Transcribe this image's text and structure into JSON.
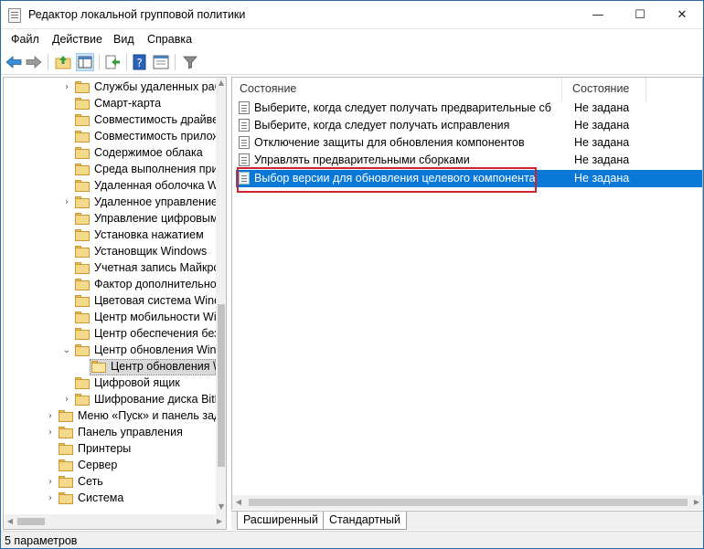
{
  "window": {
    "title": "Редактор локальной групповой политики",
    "minimize": "—",
    "maximize": "☐",
    "close": "✕"
  },
  "menu": [
    "Файл",
    "Действие",
    "Вид",
    "Справка"
  ],
  "toolbar": {
    "icons": [
      "back-arrow-icon",
      "forward-arrow-icon",
      "up-folder-icon",
      "show-hide-console-tree-icon",
      "export-list-icon",
      "help-icon",
      "properties-icon",
      "filter-icon"
    ]
  },
  "tree": {
    "items": [
      {
        "label": "Службы удаленных раб",
        "depth": 2,
        "chevron": "›"
      },
      {
        "label": "Смарт-карта",
        "depth": 2,
        "chevron": ""
      },
      {
        "label": "Совместимость драйве",
        "depth": 2,
        "chevron": ""
      },
      {
        "label": "Совместимость прилож",
        "depth": 2,
        "chevron": ""
      },
      {
        "label": "Содержимое облака",
        "depth": 2,
        "chevron": ""
      },
      {
        "label": "Среда выполнения при",
        "depth": 2,
        "chevron": ""
      },
      {
        "label": "Удаленная оболочка W",
        "depth": 2,
        "chevron": ""
      },
      {
        "label": "Удаленное управление",
        "depth": 2,
        "chevron": "›"
      },
      {
        "label": "Управление цифровым",
        "depth": 2,
        "chevron": ""
      },
      {
        "label": "Установка нажатием",
        "depth": 2,
        "chevron": ""
      },
      {
        "label": "Установщик Windows",
        "depth": 2,
        "chevron": ""
      },
      {
        "label": "Учетная запись Майкро",
        "depth": 2,
        "chevron": ""
      },
      {
        "label": "Фактор дополнительно",
        "depth": 2,
        "chevron": ""
      },
      {
        "label": "Цветовая система Wind",
        "depth": 2,
        "chevron": ""
      },
      {
        "label": "Центр мобильности Wi",
        "depth": 2,
        "chevron": ""
      },
      {
        "label": "Центр обеспечения без",
        "depth": 2,
        "chevron": ""
      },
      {
        "label": "Центр обновления Win",
        "depth": 2,
        "chevron": "⌄"
      },
      {
        "label": "Центр обновления \\",
        "depth": 3,
        "chevron": "",
        "selected": true
      },
      {
        "label": "Цифровой ящик",
        "depth": 2,
        "chevron": ""
      },
      {
        "label": "Шифрование диска BitL",
        "depth": 2,
        "chevron": "›"
      },
      {
        "label": "Меню «Пуск» и панель зада",
        "depth": 1,
        "chevron": "›"
      },
      {
        "label": "Панель управления",
        "depth": 1,
        "chevron": "›"
      },
      {
        "label": "Принтеры",
        "depth": 1,
        "chevron": ""
      },
      {
        "label": "Сервер",
        "depth": 1,
        "chevron": ""
      },
      {
        "label": "Сеть",
        "depth": 1,
        "chevron": "›"
      },
      {
        "label": "Система",
        "depth": 1,
        "chevron": "›"
      }
    ]
  },
  "list": {
    "columns": [
      "Состояние",
      "Состояние"
    ],
    "rows": [
      {
        "name": "Выберите, когда следует получать предварительные сбо...",
        "state": "Не задана"
      },
      {
        "name": "Выберите, когда следует получать исправления",
        "state": "Не задана"
      },
      {
        "name": "Отключение защиты для обновления компонентов",
        "state": "Не задана"
      },
      {
        "name": "Управлять предварительными сборками",
        "state": "Не задана"
      },
      {
        "name": "Выбор версии для обновления целевого компонента",
        "state": "Не задана",
        "selected": true
      }
    ]
  },
  "tabs": [
    "Расширенный",
    "Стандартный"
  ],
  "status": "5 параметров",
  "colors": {
    "selection": "#0a78d7",
    "highlight_box": "#d0232d",
    "folder": "#f5d98a"
  }
}
